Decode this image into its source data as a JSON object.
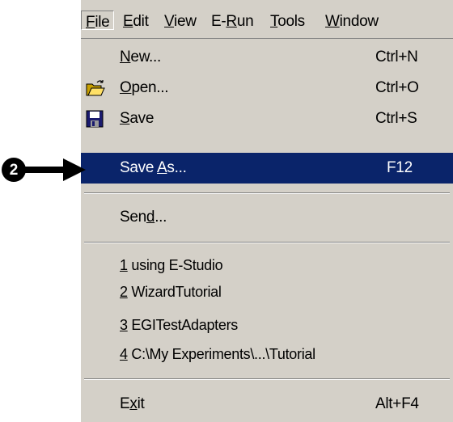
{
  "menubar": {
    "items": [
      {
        "pre": "",
        "u": "F",
        "post": "ile"
      },
      {
        "pre": "",
        "u": "E",
        "post": "dit"
      },
      {
        "pre": "",
        "u": "V",
        "post": "iew"
      },
      {
        "pre": "E-",
        "u": "R",
        "post": "un"
      },
      {
        "pre": "",
        "u": "T",
        "post": "ools"
      },
      {
        "pre": "",
        "u": "W",
        "post": "indow"
      }
    ]
  },
  "file_menu": {
    "new": {
      "pre": "",
      "u": "N",
      "post": "ew...",
      "shortcut": "Ctrl+N"
    },
    "open": {
      "pre": "",
      "u": "O",
      "post": "pen...",
      "shortcut": "Ctrl+O",
      "icon": "open-folder-icon"
    },
    "save": {
      "pre": "",
      "u": "S",
      "post": "ave",
      "shortcut": "Ctrl+S",
      "icon": "floppy-disk-icon"
    },
    "save_as": {
      "pre": "Save ",
      "u": "A",
      "post": "s...",
      "shortcut": "F12"
    },
    "send": {
      "pre": "Sen",
      "u": "d",
      "post": "..."
    },
    "recent": [
      {
        "num": "1",
        "text": " using E-Studio"
      },
      {
        "num": "2",
        "text": " WizardTutorial"
      },
      {
        "num": "3",
        "text": " EGITestAdapters"
      },
      {
        "num": "4",
        "text": " C:\\My Experiments\\...\\Tutorial"
      }
    ],
    "exit": {
      "pre": "E",
      "u": "x",
      "post": "it",
      "shortcut": "Alt+F4"
    }
  },
  "callout": {
    "number": "2",
    "icon": "right-arrow-icon"
  },
  "colors": {
    "highlight": "#0a246a",
    "menu_bg": "#d4d0c8"
  }
}
